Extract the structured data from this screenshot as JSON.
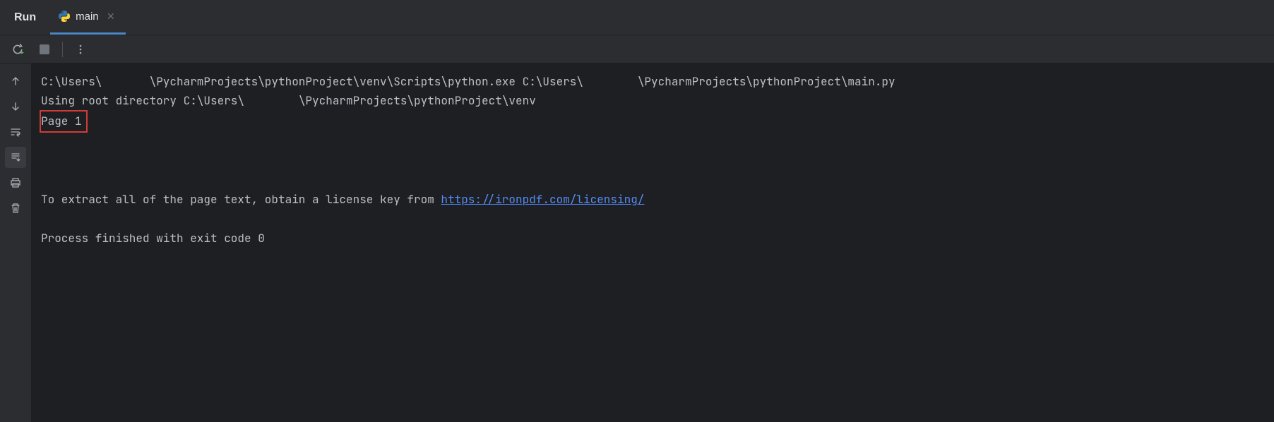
{
  "header": {
    "run_label": "Run",
    "tab": {
      "label": "main",
      "icon": "python-icon"
    }
  },
  "console": {
    "line1_part1": "C:\\Users\\",
    "line1_part2": "\\PycharmProjects\\pythonProject\\venv\\Scripts\\python.exe C:\\Users\\",
    "line1_part3": "\\PycharmProjects\\pythonProject\\main.py ",
    "line2_part1": "Using root directory C:\\Users\\",
    "line2_part2": "\\PycharmProjects\\pythonProject\\venv",
    "line3": "Page 1",
    "line4": "To extract all of the page text, obtain a license key from ",
    "line4_link": "https://ironpdf.com/licensing/",
    "line5": "Process finished with exit code 0"
  }
}
